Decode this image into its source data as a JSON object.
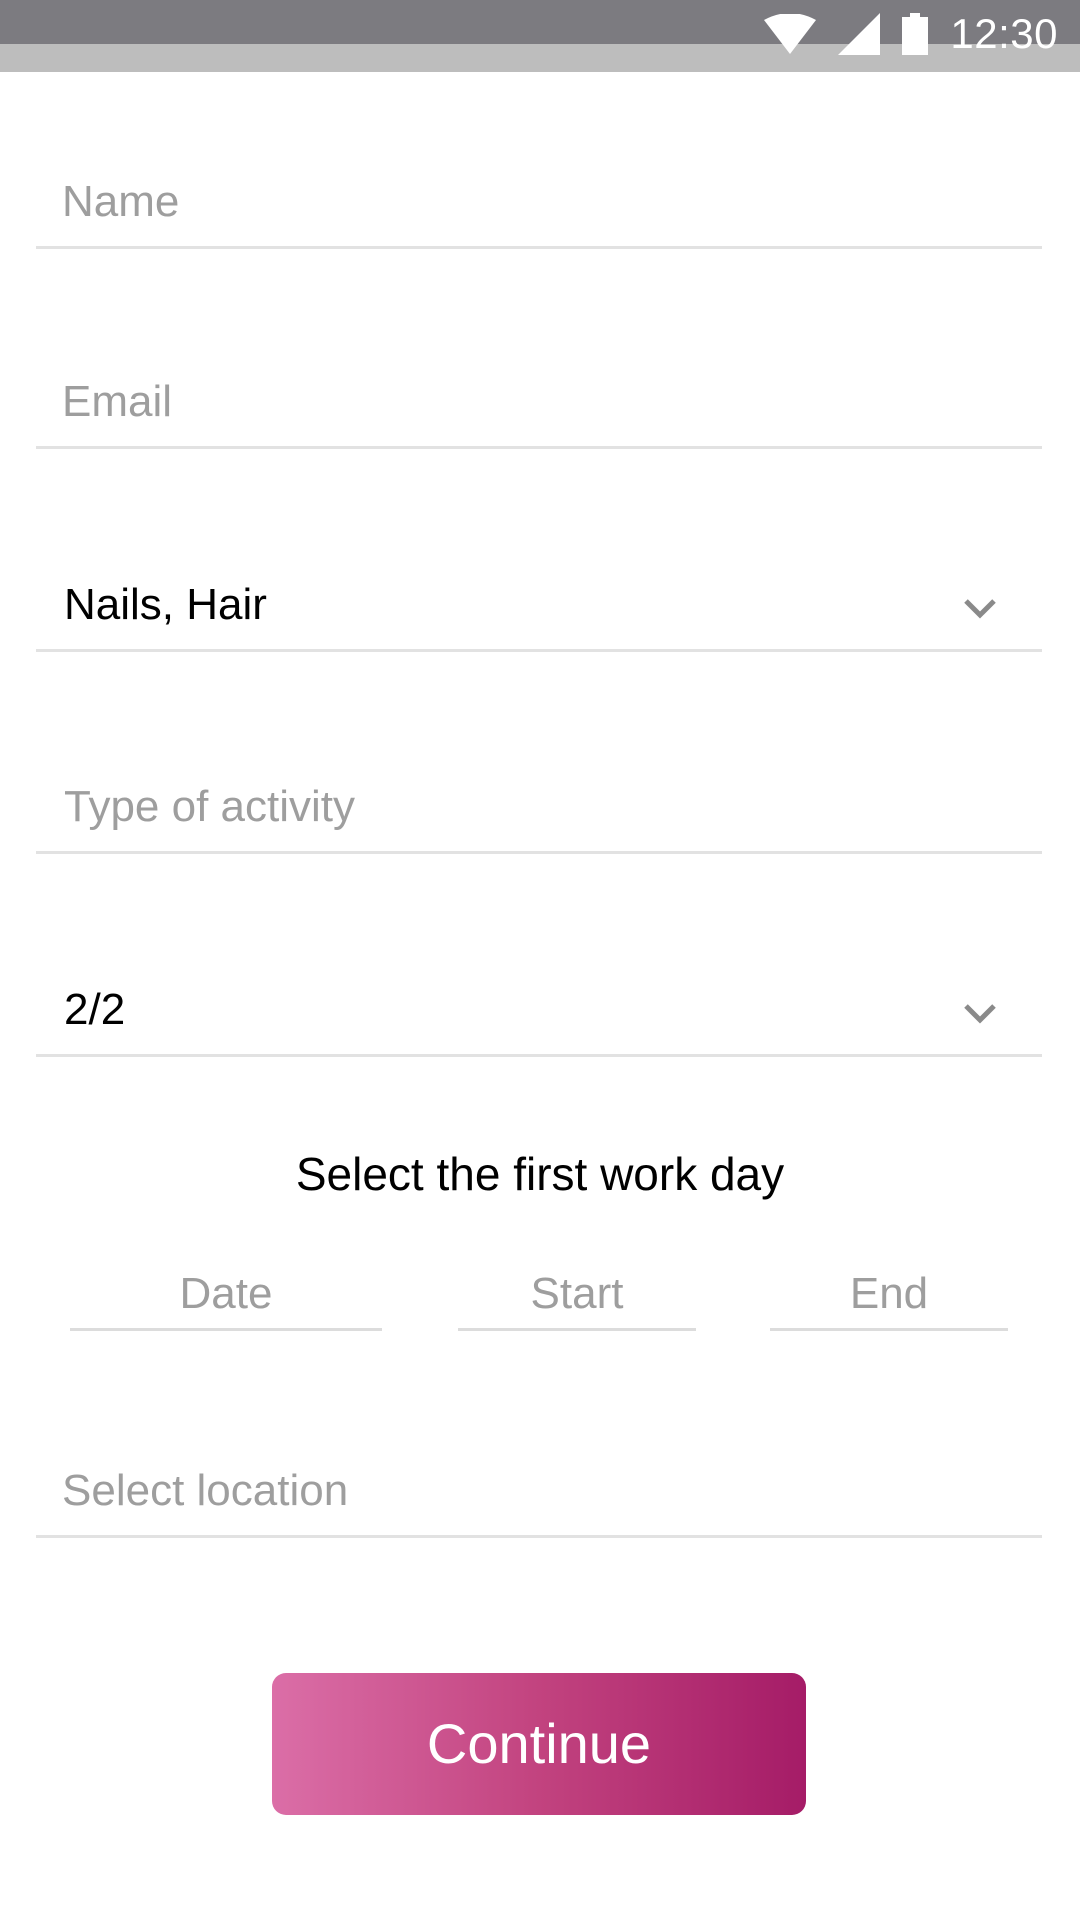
{
  "status_bar": {
    "time": "12:30",
    "icons": [
      "wifi-icon",
      "cellular-signal-icon",
      "battery-icon"
    ]
  },
  "form": {
    "name": {
      "placeholder": "Name"
    },
    "email": {
      "placeholder": "Email"
    },
    "category": {
      "value": "Nails, Hair",
      "icon": "chevron-down-icon"
    },
    "activity": {
      "placeholder": "Type of activity"
    },
    "schedule": {
      "value": "2/2",
      "icon": "chevron-down-icon"
    },
    "first_work_day": {
      "title": "Select the first work day",
      "date_placeholder": "Date",
      "start_placeholder": "Start",
      "end_placeholder": "End"
    },
    "location": {
      "placeholder": "Select location"
    }
  },
  "actions": {
    "continue_label": "Continue"
  },
  "colors": {
    "status_bar": "#7c7b80",
    "status_strip": "#bdbdbd",
    "placeholder": "#9e9e9e",
    "divider": "#e2e2e2",
    "button_gradient_start": "#db6ea7",
    "button_gradient_end": "#a51c67"
  }
}
